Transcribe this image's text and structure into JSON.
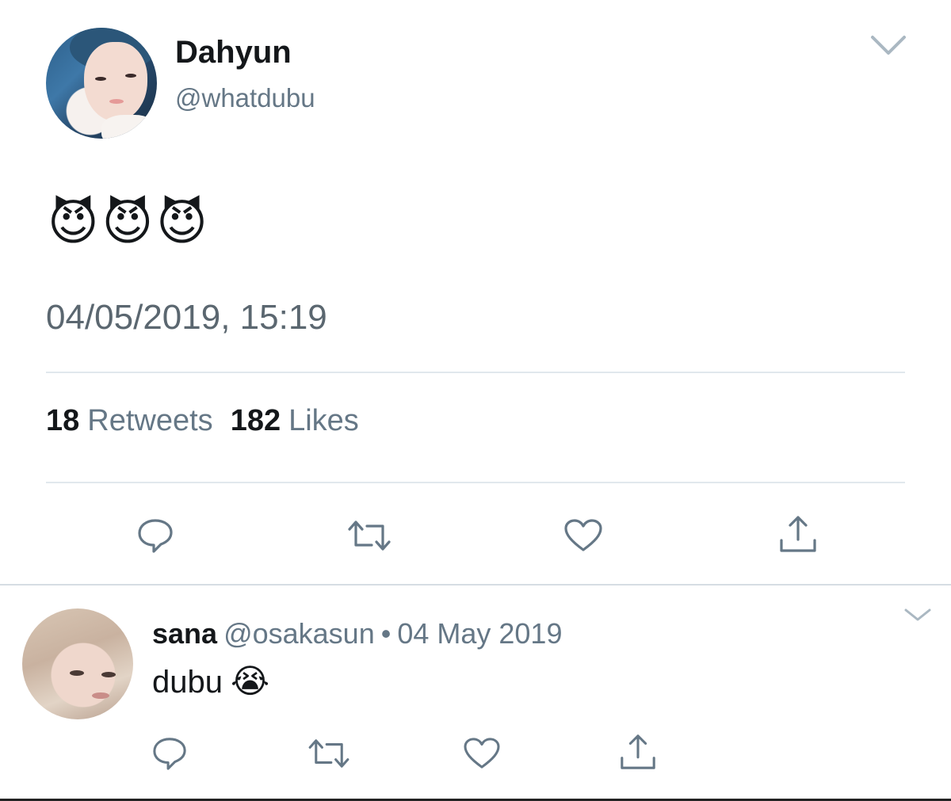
{
  "tweet": {
    "display_name": "Dahyun",
    "handle": "@whatdubu",
    "text": "😈😈😈",
    "timestamp": "04/05/2019, 15:19",
    "retweets_count": "18",
    "retweets_label": "Retweets",
    "likes_count": "182",
    "likes_label": "Likes",
    "actions": [
      "reply-icon",
      "retweet-icon",
      "like-icon",
      "share-icon"
    ]
  },
  "reply": {
    "display_name": "sana",
    "handle": "@osakasun",
    "separator": "•",
    "date": "04 May 2019",
    "text": "dubu",
    "emoji": "😭",
    "actions": [
      "reply-icon",
      "retweet-icon",
      "like-icon",
      "share-icon"
    ]
  },
  "colors": {
    "text_primary": "#14171a",
    "text_secondary": "#657786",
    "divider": "#e1e8ed",
    "icon": "#657786"
  }
}
